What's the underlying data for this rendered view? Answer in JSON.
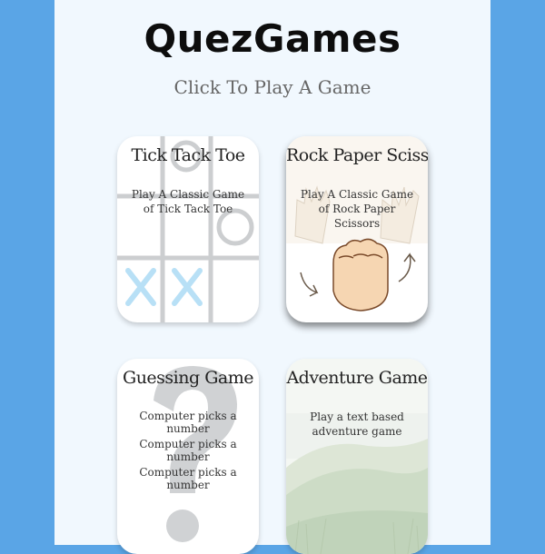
{
  "header": {
    "title": "QuezGames",
    "subtitle": "Click To Play A Game"
  },
  "cards": [
    {
      "title": "Tick Tack Toe",
      "description": "Play A Classic Game of Tick Tack Toe",
      "image": "tic-tac-toe-board"
    },
    {
      "title": "Rock Paper Scissors",
      "description": "Play A Classic Game of Rock Paper Scissors",
      "image": "rock-paper-scissors-hands"
    },
    {
      "title": "Guessing Game",
      "lines": [
        "Computer picks a number",
        "Computer picks a number",
        "Computer picks a number"
      ],
      "image": "question-mark"
    },
    {
      "title": "Adventure Game",
      "description": "Play a text based adventure game",
      "image": "grassy-hill-landscape"
    }
  ],
  "colors": {
    "outer_background": "#5aa5e6",
    "page_background": "#f1f8fe",
    "card_background": "#ffffff"
  }
}
